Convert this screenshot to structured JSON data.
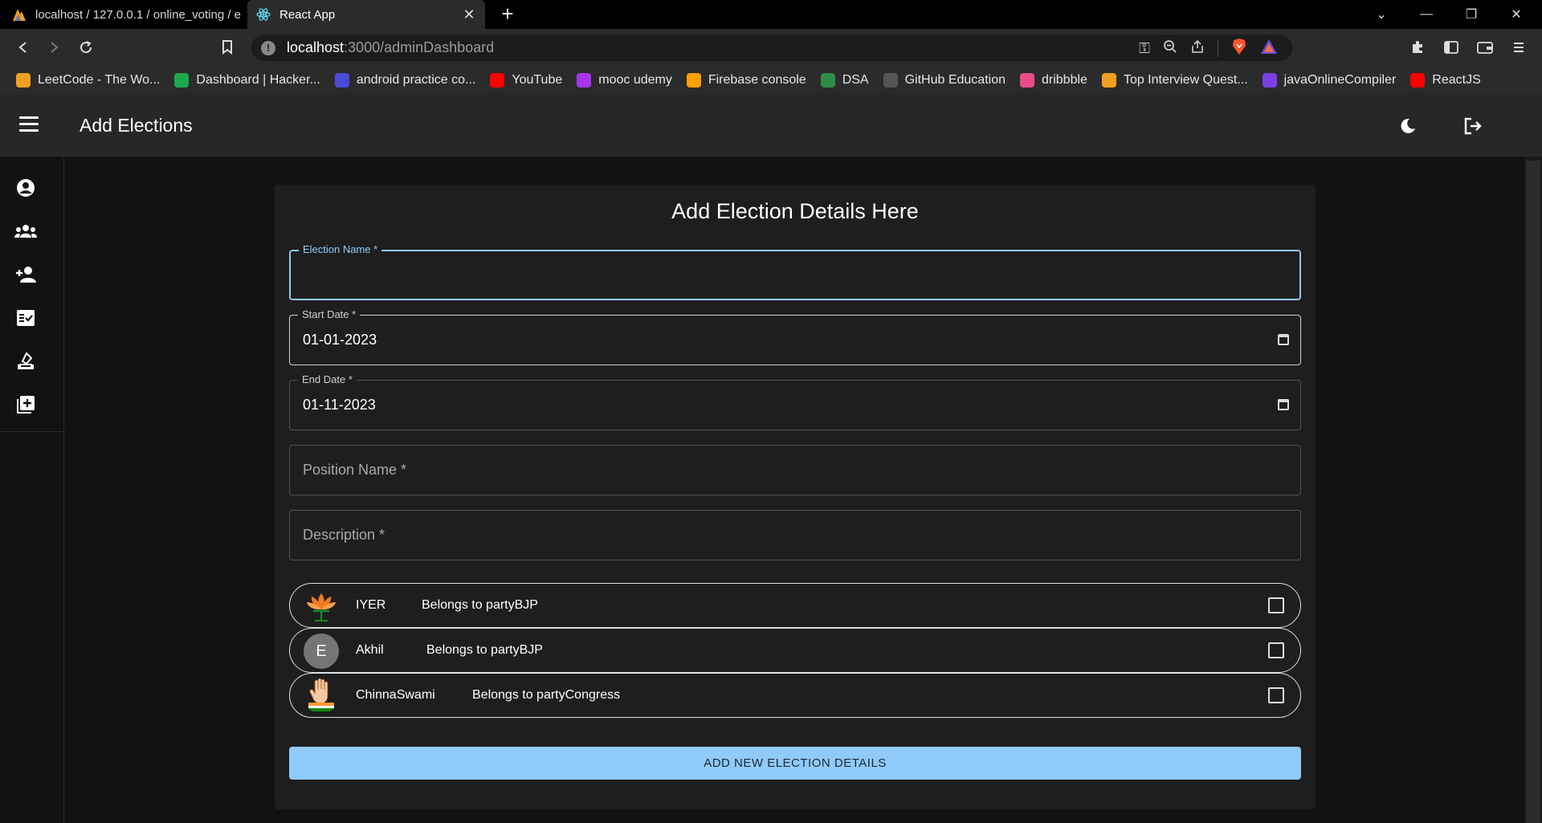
{
  "browser": {
    "tabs": [
      {
        "title": "localhost / 127.0.0.1 / online_voting / e"
      },
      {
        "title": "React App"
      }
    ],
    "url_host": "localhost",
    "url_path": ":3000/adminDashboard",
    "bookmarks": [
      {
        "label": "LeetCode - The Wo...",
        "color": "#f0a020"
      },
      {
        "label": "Dashboard | Hacker...",
        "color": "#1ba94c"
      },
      {
        "label": "android practice co...",
        "color": "#4b4bd8"
      },
      {
        "label": "YouTube",
        "color": "#ff0000"
      },
      {
        "label": "mooc udemy",
        "color": "#a435f0"
      },
      {
        "label": "Firebase console",
        "color": "#ffa000"
      },
      {
        "label": "DSA",
        "color": "#2f8d46"
      },
      {
        "label": "GitHub Education",
        "color": "#555555"
      },
      {
        "label": "dribbble",
        "color": "#ea4c89"
      },
      {
        "label": "Top Interview Quest...",
        "color": "#f0a020"
      },
      {
        "label": "javaOnlineCompiler",
        "color": "#7b3fe4"
      },
      {
        "label": "ReactJS",
        "color": "#ff0000"
      }
    ]
  },
  "appbar": {
    "title": "Add Elections"
  },
  "form": {
    "heading": "Add Election Details Here",
    "election_name": {
      "label": "Election Name *",
      "value": ""
    },
    "start_date": {
      "label": "Start Date *",
      "value": "01-01-2023"
    },
    "end_date": {
      "label": "End Date *",
      "value": "01-11-2023"
    },
    "position_name": {
      "placeholder": "Position Name *"
    },
    "description": {
      "placeholder": "Description *"
    },
    "candidates": [
      {
        "name": "IYER",
        "party": "Belongs to partyBJP",
        "avatar": "bjp-lotus"
      },
      {
        "name": "Akhil",
        "party": "Belongs to partyBJP",
        "avatar": "E"
      },
      {
        "name": "ChinnaSwami",
        "party": "Belongs to partyCongress",
        "avatar": "congress-hand"
      }
    ],
    "submit_label": "ADD NEW ELECTION DETAILS"
  },
  "colors": {
    "accent": "#90caf9",
    "appbar": "#272727",
    "card": "#1e1e1e"
  }
}
